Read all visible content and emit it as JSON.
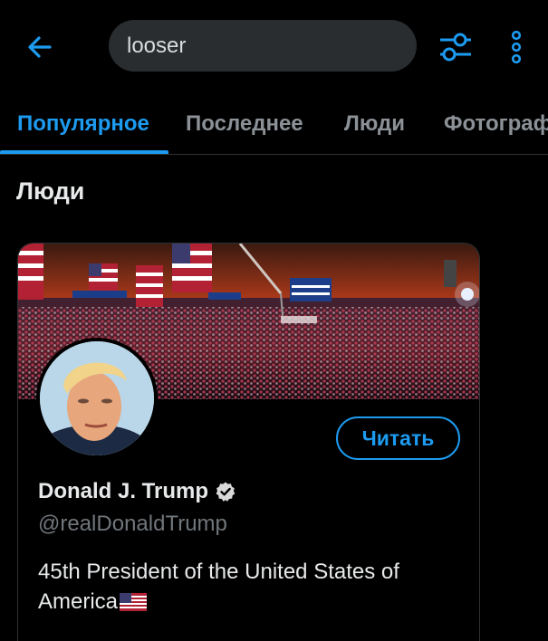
{
  "search": {
    "query": "looser"
  },
  "icons": {
    "back": "arrow-left-icon",
    "filter": "sliders-icon",
    "more": "more-vertical-icon",
    "verified": "verified-badge-icon"
  },
  "tabs": [
    {
      "label": "Популярное",
      "active": true
    },
    {
      "label": "Последнее",
      "active": false
    },
    {
      "label": "Люди",
      "active": false
    },
    {
      "label": "Фотограф",
      "active": false
    }
  ],
  "section": {
    "title": "Люди"
  },
  "profile": {
    "name": "Donald J. Trump",
    "handle": "@realDonaldTrump",
    "bio": "45th President of the United States of America",
    "bio_emoji": "us-flag-icon",
    "follow_label": "Читать",
    "verified": true
  },
  "colors": {
    "accent": "#1d9bf0",
    "background": "#000000",
    "muted": "#71767b"
  }
}
